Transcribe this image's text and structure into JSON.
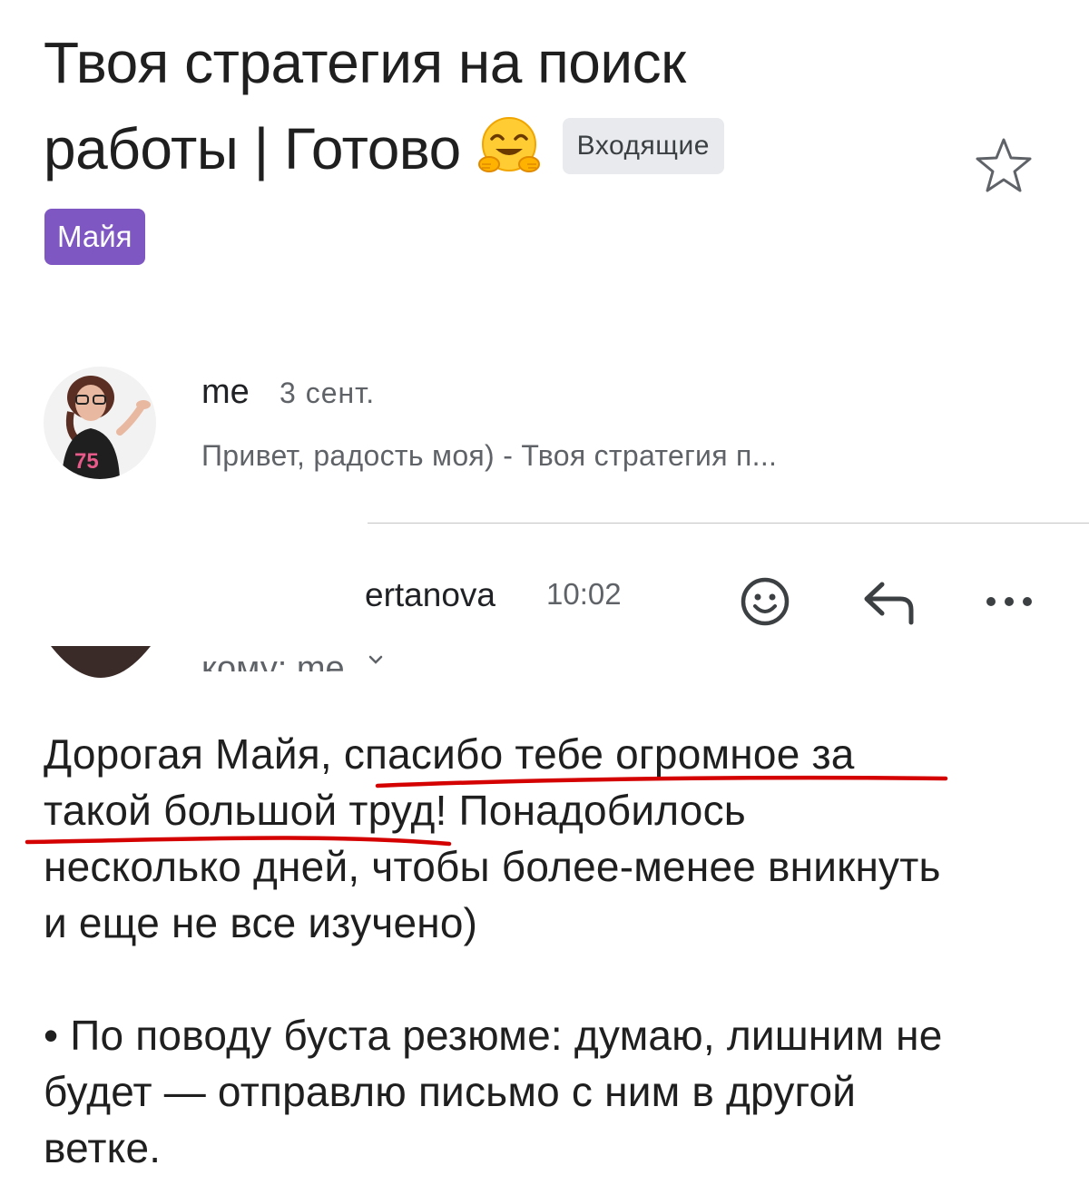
{
  "thread": {
    "subject_line1": "Твоя стратегия на поиск",
    "subject_line2": "работы | Готово",
    "subject_emoji": "hugging-face",
    "inbox_chip": "Входящие",
    "label_chip": "Майя",
    "star_icon": "star-outline-icon"
  },
  "message1": {
    "sender": "me",
    "date": "3 сент.",
    "snippet": "Привет, радость моя) - Твоя стратегия п..."
  },
  "message2": {
    "sender": "ertanova",
    "time": "10:02",
    "to_line": "кому: me",
    "actions": [
      "emoji-reaction-icon",
      "reply-icon",
      "more-options-icon"
    ],
    "body": {
      "paragraph1_line1": "Дорогая Майя, спасибо тебе огромное за",
      "paragraph1_line2": "такой большой труд! Понадобилось",
      "paragraph1_line3": "несколько дней, чтобы более-менее вникнуть",
      "paragraph1_line4": "и еще не все изучено)",
      "paragraph2_line1": "• По поводу буста резюме: думаю, лишним не",
      "paragraph2_line2": "будет — отправлю письмо с ним в другой",
      "paragraph2_line3": "ветке."
    }
  },
  "colors": {
    "label_purple": "#7e57c2",
    "underline_red": "#d40000",
    "chip_gray": "#e8eaed"
  }
}
